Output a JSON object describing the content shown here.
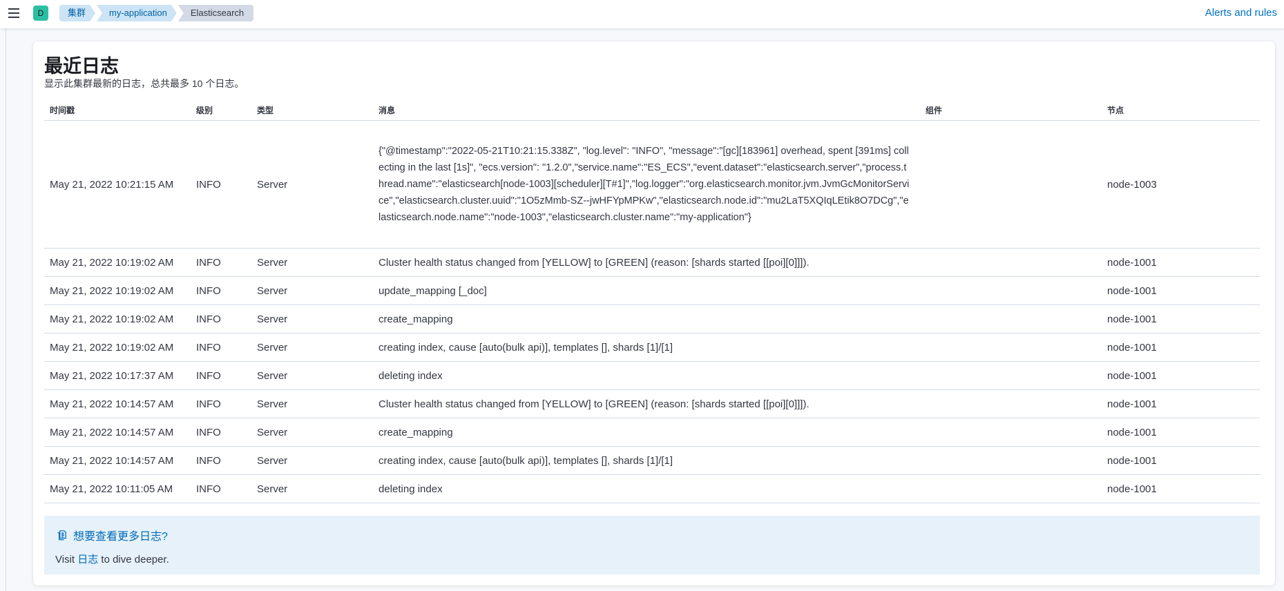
{
  "header": {
    "space_initial": "D",
    "breadcrumbs": [
      "集群",
      "my-application",
      "Elasticsearch"
    ],
    "alerts_label": "Alerts and rules"
  },
  "panel": {
    "title": "最近日志",
    "description": "显示此集群最新的日志，总共最多 10 个日志。"
  },
  "table": {
    "columns": [
      "时间戳",
      "级别",
      "类型",
      "消息",
      "组件",
      "节点"
    ],
    "rows": [
      {
        "timestamp": "May 21, 2022 10:21:15 AM",
        "level": "INFO",
        "type": "Server",
        "message": "{\"@timestamp\":\"2022-05-21T10:21:15.338Z\", \"log.level\": \"INFO\", \"message\":\"[gc][183961] overhead, spent [391ms] collecting in the last [1s]\", \"ecs.version\": \"1.2.0\",\"service.name\":\"ES_ECS\",\"event.dataset\":\"elasticsearch.server\",\"process.thread.name\":\"elasticsearch[node-1003][scheduler][T#1]\",\"log.logger\":\"org.elasticsearch.monitor.jvm.JvmGcMonitorService\",\"elasticsearch.cluster.uuid\":\"1O5zMmb-SZ--jwHFYpMPKw\",\"elasticsearch.node.id\":\"mu2LaT5XQIqLEtik8O7DCg\",\"elasticsearch.node.name\":\"node-1003\",\"elasticsearch.cluster.name\":\"my-application\"}",
        "component": "",
        "node": "node-1003"
      },
      {
        "timestamp": "May 21, 2022 10:19:02 AM",
        "level": "INFO",
        "type": "Server",
        "message": "Cluster health status changed from [YELLOW] to [GREEN] (reason: [shards started [[poi][0]]]).",
        "component": "",
        "node": "node-1001"
      },
      {
        "timestamp": "May 21, 2022 10:19:02 AM",
        "level": "INFO",
        "type": "Server",
        "message": "update_mapping [_doc]",
        "component": "",
        "node": "node-1001"
      },
      {
        "timestamp": "May 21, 2022 10:19:02 AM",
        "level": "INFO",
        "type": "Server",
        "message": "create_mapping",
        "component": "",
        "node": "node-1001"
      },
      {
        "timestamp": "May 21, 2022 10:19:02 AM",
        "level": "INFO",
        "type": "Server",
        "message": "creating index, cause [auto(bulk api)], templates [], shards [1]/[1]",
        "component": "",
        "node": "node-1001"
      },
      {
        "timestamp": "May 21, 2022 10:17:37 AM",
        "level": "INFO",
        "type": "Server",
        "message": "deleting index",
        "component": "",
        "node": "node-1001"
      },
      {
        "timestamp": "May 21, 2022 10:14:57 AM",
        "level": "INFO",
        "type": "Server",
        "message": "Cluster health status changed from [YELLOW] to [GREEN] (reason: [shards started [[poi][0]]]).",
        "component": "",
        "node": "node-1001"
      },
      {
        "timestamp": "May 21, 2022 10:14:57 AM",
        "level": "INFO",
        "type": "Server",
        "message": "create_mapping",
        "component": "",
        "node": "node-1001"
      },
      {
        "timestamp": "May 21, 2022 10:14:57 AM",
        "level": "INFO",
        "type": "Server",
        "message": "creating index, cause [auto(bulk api)], templates [], shards [1]/[1]",
        "component": "",
        "node": "node-1001"
      },
      {
        "timestamp": "May 21, 2022 10:11:05 AM",
        "level": "INFO",
        "type": "Server",
        "message": "deleting index",
        "component": "",
        "node": "node-1001"
      }
    ]
  },
  "callout": {
    "icon": "logs-app-icon",
    "title": "想要查看更多日志?",
    "text_before": "Visit ",
    "link": "日志",
    "text_after": " to dive deeper."
  }
}
